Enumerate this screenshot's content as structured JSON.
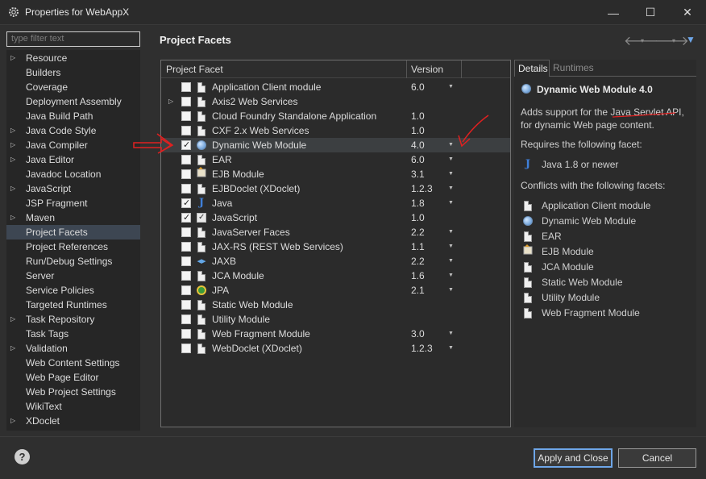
{
  "window": {
    "title": "Properties for WebAppX",
    "minimize": "—",
    "maximize": "☐",
    "close": "✕"
  },
  "filter": {
    "placeholder": "type filter text"
  },
  "sidebar": {
    "items": [
      {
        "label": "Resource",
        "expandable": true
      },
      {
        "label": "Builders",
        "expandable": false
      },
      {
        "label": "Coverage",
        "expandable": false
      },
      {
        "label": "Deployment Assembly",
        "expandable": false
      },
      {
        "label": "Java Build Path",
        "expandable": false
      },
      {
        "label": "Java Code Style",
        "expandable": true
      },
      {
        "label": "Java Compiler",
        "expandable": true
      },
      {
        "label": "Java Editor",
        "expandable": true
      },
      {
        "label": "Javadoc Location",
        "expandable": false
      },
      {
        "label": "JavaScript",
        "expandable": true
      },
      {
        "label": "JSP Fragment",
        "expandable": false
      },
      {
        "label": "Maven",
        "expandable": true
      },
      {
        "label": "Project Facets",
        "expandable": false,
        "selected": true
      },
      {
        "label": "Project References",
        "expandable": false
      },
      {
        "label": "Run/Debug Settings",
        "expandable": false
      },
      {
        "label": "Server",
        "expandable": false
      },
      {
        "label": "Service Policies",
        "expandable": false
      },
      {
        "label": "Targeted Runtimes",
        "expandable": false
      },
      {
        "label": "Task Repository",
        "expandable": true
      },
      {
        "label": "Task Tags",
        "expandable": false
      },
      {
        "label": "Validation",
        "expandable": true
      },
      {
        "label": "Web Content Settings",
        "expandable": false
      },
      {
        "label": "Web Page Editor",
        "expandable": false
      },
      {
        "label": "Web Project Settings",
        "expandable": false
      },
      {
        "label": "WikiText",
        "expandable": false
      },
      {
        "label": "XDoclet",
        "expandable": true
      }
    ]
  },
  "header": {
    "title": "Project Facets"
  },
  "facets": {
    "col_facet": "Project Facet",
    "col_version": "Version",
    "rows": [
      {
        "name": "Application Client module",
        "version": "6.0",
        "checked": false,
        "icon": "doc-icon",
        "expandable": false,
        "dropdown": true
      },
      {
        "name": "Axis2 Web Services",
        "version": "",
        "checked": false,
        "icon": "doc-icon",
        "expandable": true,
        "dropdown": false
      },
      {
        "name": "Cloud Foundry Standalone Application",
        "version": "1.0",
        "checked": false,
        "icon": "doc-icon",
        "expandable": false,
        "dropdown": false
      },
      {
        "name": "CXF 2.x Web Services",
        "version": "1.0",
        "checked": false,
        "icon": "doc-icon",
        "expandable": false,
        "dropdown": false
      },
      {
        "name": "Dynamic Web Module",
        "version": "4.0",
        "checked": true,
        "icon": "globe-icon",
        "expandable": false,
        "dropdown": true,
        "selected": true
      },
      {
        "name": "EAR",
        "version": "6.0",
        "checked": false,
        "icon": "doc-icon",
        "expandable": false,
        "dropdown": true
      },
      {
        "name": "EJB Module",
        "version": "3.1",
        "checked": false,
        "icon": "ejb-icon",
        "expandable": false,
        "dropdown": true
      },
      {
        "name": "EJBDoclet (XDoclet)",
        "version": "1.2.3",
        "checked": false,
        "icon": "doc-icon",
        "expandable": false,
        "dropdown": true
      },
      {
        "name": "Java",
        "version": "1.8",
        "checked": true,
        "icon": "j-icon",
        "expandable": false,
        "dropdown": true
      },
      {
        "name": "JavaScript",
        "version": "1.0",
        "checked": true,
        "icon": "js-icon",
        "expandable": false,
        "dropdown": false
      },
      {
        "name": "JavaServer Faces",
        "version": "2.2",
        "checked": false,
        "icon": "doc-icon",
        "expandable": false,
        "dropdown": true
      },
      {
        "name": "JAX-RS (REST Web Services)",
        "version": "1.1",
        "checked": false,
        "icon": "doc-icon",
        "expandable": false,
        "dropdown": true
      },
      {
        "name": "JAXB",
        "version": "2.2",
        "checked": false,
        "icon": "jaxb-icon",
        "expandable": false,
        "dropdown": true
      },
      {
        "name": "JCA Module",
        "version": "1.6",
        "checked": false,
        "icon": "doc-icon",
        "expandable": false,
        "dropdown": true
      },
      {
        "name": "JPA",
        "version": "2.1",
        "checked": false,
        "icon": "jpa-icon",
        "expandable": false,
        "dropdown": true
      },
      {
        "name": "Static Web Module",
        "version": "",
        "checked": false,
        "icon": "doc-icon",
        "expandable": false,
        "dropdown": false
      },
      {
        "name": "Utility Module",
        "version": "",
        "checked": false,
        "icon": "doc-icon",
        "expandable": false,
        "dropdown": false
      },
      {
        "name": "Web Fragment Module",
        "version": "3.0",
        "checked": false,
        "icon": "doc-icon",
        "expandable": false,
        "dropdown": true
      },
      {
        "name": "WebDoclet (XDoclet)",
        "version": "1.2.3",
        "checked": false,
        "icon": "doc-icon",
        "expandable": false,
        "dropdown": true
      }
    ]
  },
  "details": {
    "tab_details": "Details",
    "tab_runtimes": "Runtimes",
    "title": "Dynamic Web Module 4.0",
    "description": "Adds support for the Java Servlet API, for dynamic Web page content.",
    "requires_label": "Requires the following facet:",
    "requires": [
      {
        "name": "Java 1.8 or newer",
        "icon": "j-icon"
      }
    ],
    "conflicts_label": "Conflicts with the following facets:",
    "conflicts": [
      {
        "name": "Application Client module",
        "icon": "doc-icon"
      },
      {
        "name": "Dynamic Web Module",
        "icon": "globe-icon"
      },
      {
        "name": "EAR",
        "icon": "doc-icon"
      },
      {
        "name": "EJB Module",
        "icon": "ejb-icon"
      },
      {
        "name": "JCA Module",
        "icon": "doc-icon"
      },
      {
        "name": "Static Web Module",
        "icon": "doc-icon"
      },
      {
        "name": "Utility Module",
        "icon": "doc-icon"
      },
      {
        "name": "Web Fragment Module",
        "icon": "doc-icon"
      }
    ]
  },
  "buttons": {
    "apply_close": "Apply and Close",
    "cancel": "Cancel",
    "help": "?"
  },
  "colors": {
    "background": "#2f2f2f",
    "selection": "#3d4652",
    "annotation": "#e02020",
    "accent": "#6ea6e8"
  }
}
